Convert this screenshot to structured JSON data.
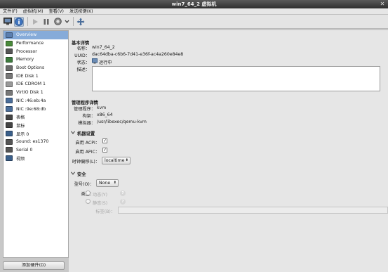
{
  "window": {
    "title": "win7_64_2 虚拟机",
    "close": "✕"
  },
  "menu": [
    "文件(F)",
    "虚拟机(M)",
    "查看(V)",
    "发送按键(K)"
  ],
  "sidebar": {
    "items": [
      {
        "label": "Overview",
        "icon": "overview-icon",
        "color": "#5b7fb0"
      },
      {
        "label": "Performance",
        "icon": "performance-icon",
        "color": "#4a8a3a"
      },
      {
        "label": "Processor",
        "icon": "processor-icon",
        "color": "#555555"
      },
      {
        "label": "Memory",
        "icon": "memory-icon",
        "color": "#3d7a3d"
      },
      {
        "label": "Boot Options",
        "icon": "boot-options-icon",
        "color": "#6a6a6a"
      },
      {
        "label": "IDE Disk 1",
        "icon": "disk-icon",
        "color": "#777777"
      },
      {
        "label": "IDE CDROM 1",
        "icon": "cdrom-icon",
        "color": "#999999"
      },
      {
        "label": "VirtIO Disk 1",
        "icon": "disk-icon",
        "color": "#777777"
      },
      {
        "label": "NIC :46:eb:4a",
        "icon": "network-icon",
        "color": "#4a6d9a"
      },
      {
        "label": "NIC :9e:68:db",
        "icon": "network-icon",
        "color": "#4a6d9a"
      },
      {
        "label": "表格",
        "icon": "tablet-icon",
        "color": "#444444"
      },
      {
        "label": "鼠标",
        "icon": "mouse-icon",
        "color": "#444444"
      },
      {
        "label": "显示 0",
        "icon": "display-icon",
        "color": "#3a5f8a"
      },
      {
        "label": "Sound: es1370",
        "icon": "sound-icon",
        "color": "#555555"
      },
      {
        "label": "Serial 0",
        "icon": "serial-icon",
        "color": "#555555"
      },
      {
        "label": "视频",
        "icon": "video-icon",
        "color": "#3a5f8a"
      }
    ],
    "add_hardware": "添加硬件(D)"
  },
  "basic": {
    "heading": "基本详情",
    "name_label": "名称：",
    "name_value": "win7_64_2",
    "uuid_label": "UUID：",
    "uuid_value": "dac64dba-c6b6-7d41-e36f-ac4a260e84e8",
    "status_label": "状态：",
    "status_value": "运行中",
    "desc_label": "描述："
  },
  "hypervisor": {
    "heading": "管理程序详情",
    "hv_label": "管理程序：",
    "hv_value": "kvm",
    "arch_label": "构架：",
    "arch_value": "x86_64",
    "emu_label": "模拟器：",
    "emu_value": "/usr/libexec/qemu-kvm"
  },
  "machine": {
    "heading": "机器设置",
    "acpi_label": "启用 ACPI：",
    "apic_label": "启用 APIC：",
    "clock_label": "时钟偏移(L)：",
    "clock_value": "localtime",
    "check": "✓"
  },
  "security": {
    "heading": "安全",
    "model_label": "型号(O)：",
    "model_value": "None",
    "type_label": "类型：",
    "dynamic_label": "动态(Y)",
    "static_label": "静态(S)",
    "label_label": "标签(B)：",
    "help": "?"
  },
  "colors": {
    "selection": "#86abd9",
    "titlebar": "#3a3a3a"
  }
}
